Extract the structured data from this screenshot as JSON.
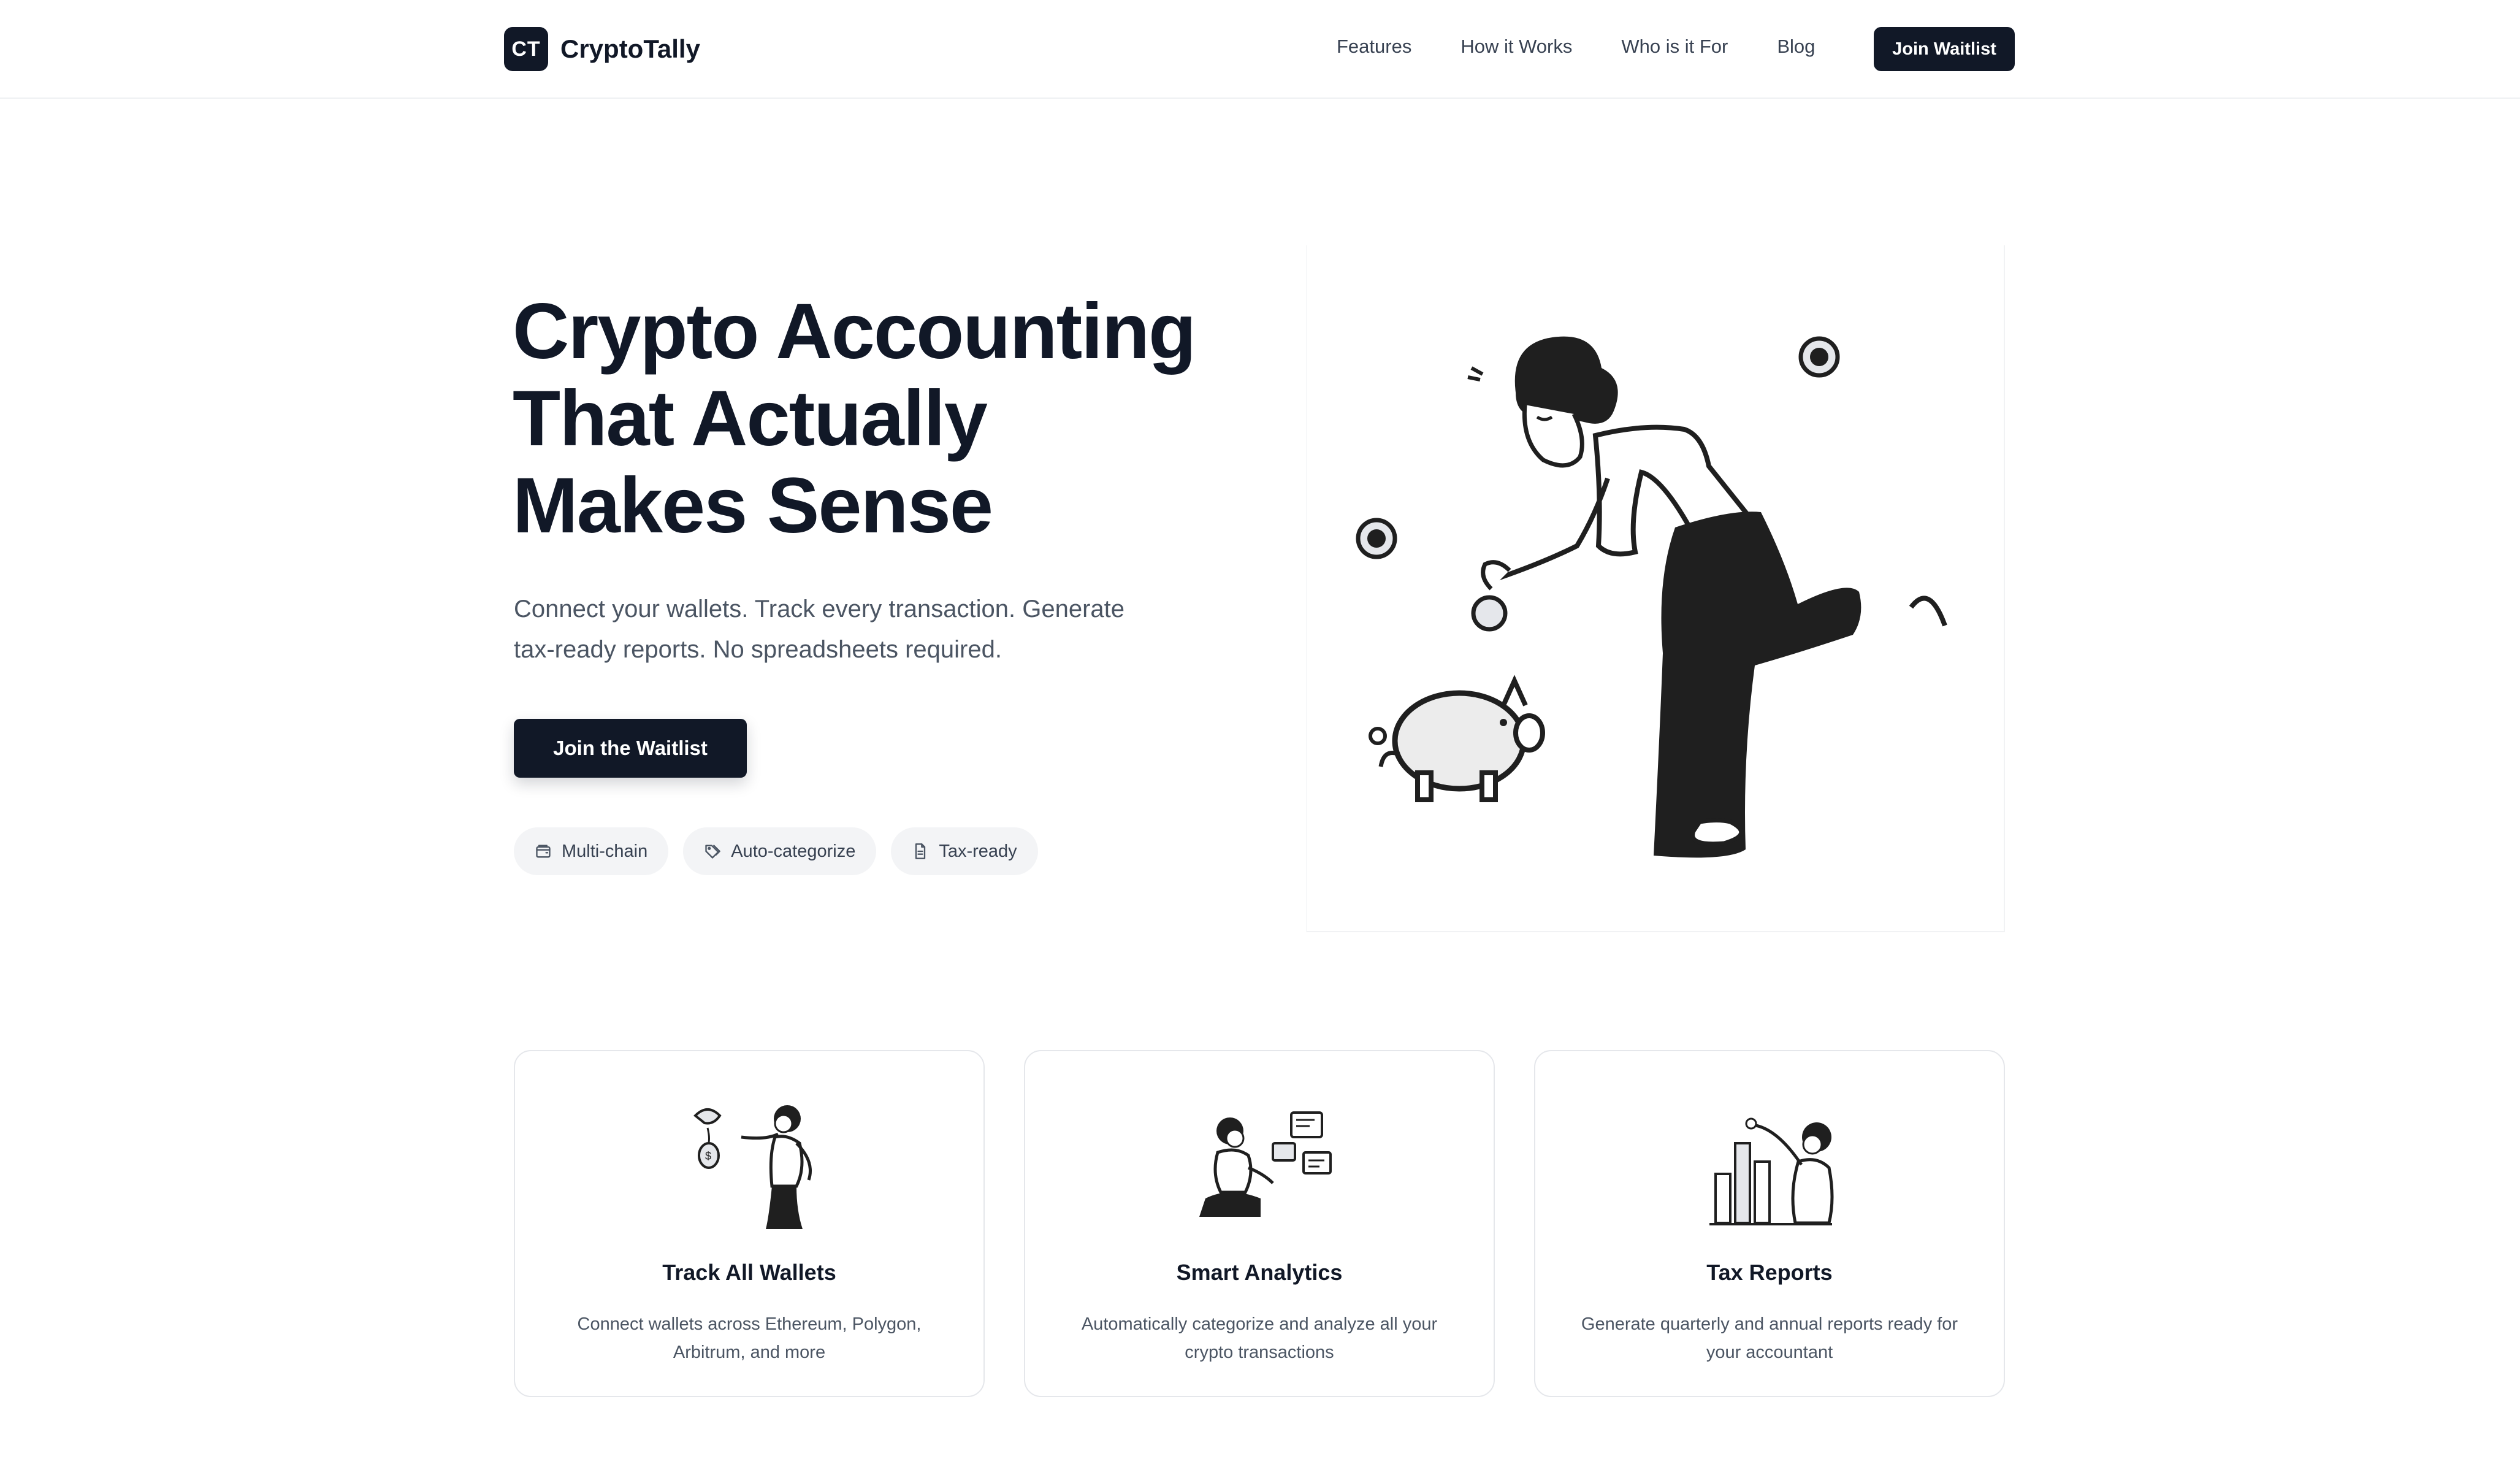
{
  "brand": {
    "mark": "CT",
    "name": "CryptoTally"
  },
  "nav": {
    "links": [
      "Features",
      "How it Works",
      "Who is it For",
      "Blog"
    ],
    "cta": "Join Waitlist"
  },
  "hero": {
    "title_lines": [
      "Crypto Accounting",
      "That Actually",
      "Makes Sense"
    ],
    "subtitle_lines": [
      "Connect your wallets. Track every transaction. Generate",
      "tax-ready reports. No spreadsheets required."
    ],
    "cta": "Join the Waitlist",
    "pills": [
      {
        "label": "Multi-chain",
        "icon": "wallet-icon"
      },
      {
        "label": "Auto-categorize",
        "icon": "tag-icon"
      },
      {
        "label": "Tax-ready",
        "icon": "document-icon"
      }
    ],
    "illustration": "person-dropping-coin-into-piggy-bank"
  },
  "features": [
    {
      "title": "Track All Wallets",
      "desc_lines": [
        "Connect wallets across Ethereum, Polygon,",
        "Arbitrum, and more"
      ],
      "illustration": "person-with-bird-moneybag"
    },
    {
      "title": "Smart Analytics",
      "desc_lines": [
        "Automatically categorize and analyze all your",
        "crypto transactions"
      ],
      "illustration": "person-kneeling-with-documents"
    },
    {
      "title": "Tax Reports",
      "desc_lines": [
        "Generate quarterly and annual reports ready for",
        "your accountant"
      ],
      "illustration": "person-with-bar-chart"
    }
  ],
  "colors": {
    "primary": "#111827",
    "text": "#111827",
    "muted": "#4b5563",
    "pill_bg": "#f3f4f6",
    "border": "#e5e7eb"
  }
}
